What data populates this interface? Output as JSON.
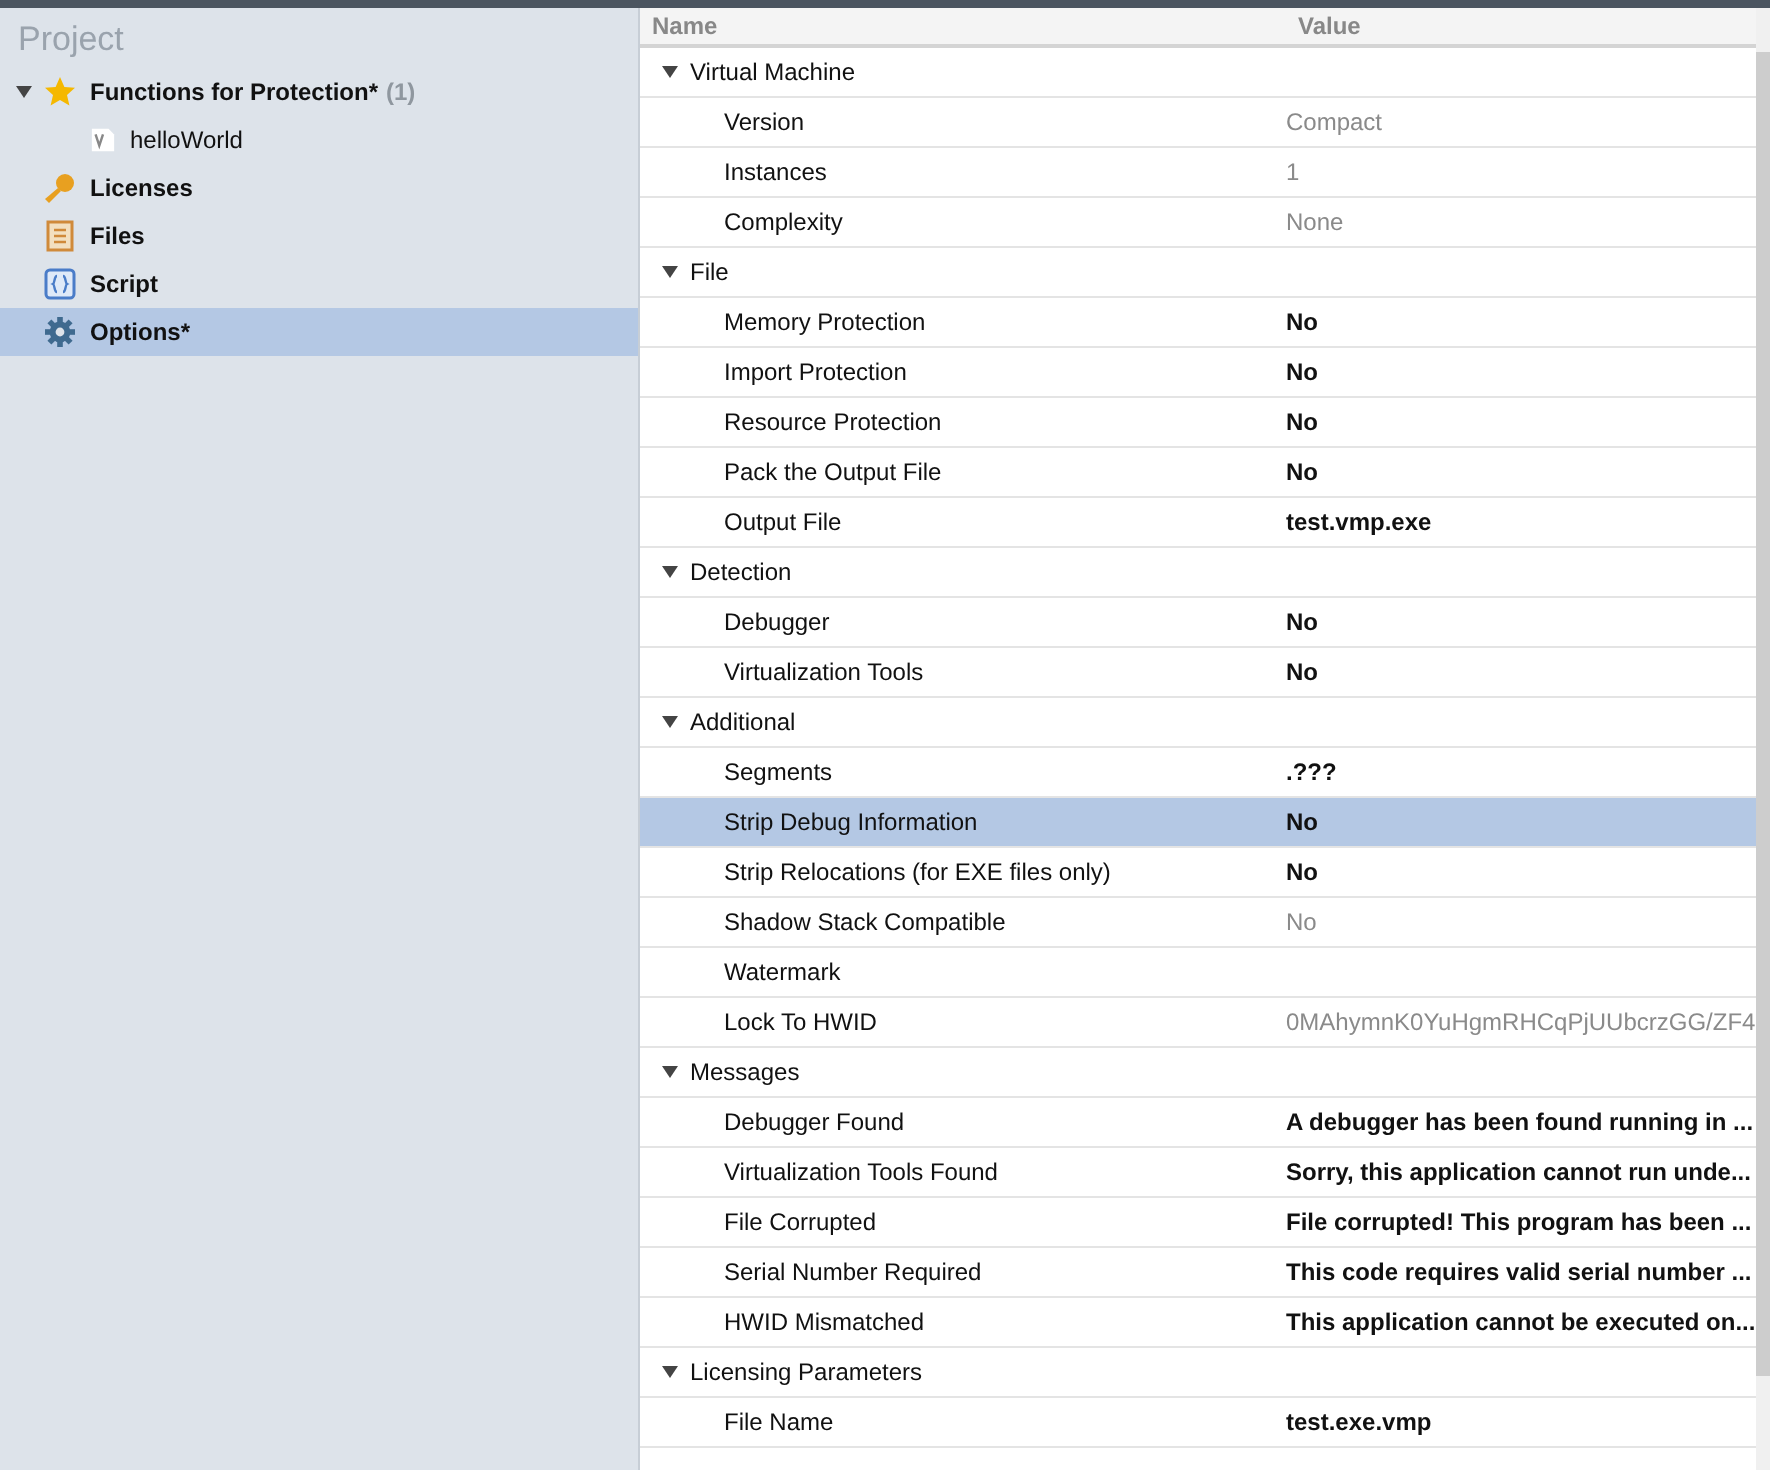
{
  "sidebar": {
    "title": "Project",
    "items": [
      {
        "label": "Functions for Protection*",
        "count": "(1)",
        "kind": "star",
        "selected": false,
        "expanded": true,
        "children": [
          {
            "label": "helloWorld",
            "kind": "vfile",
            "selected": false
          }
        ]
      },
      {
        "label": "Licenses",
        "kind": "key",
        "selected": false
      },
      {
        "label": "Files",
        "kind": "list",
        "selected": false
      },
      {
        "label": "Script",
        "kind": "braces",
        "selected": false
      },
      {
        "label": "Options*",
        "kind": "gear",
        "selected": true
      }
    ]
  },
  "table": {
    "columns": [
      "Name",
      "Value"
    ],
    "sections": [
      {
        "name": "Virtual Machine",
        "expanded": true,
        "rows": [
          {
            "name": "Version",
            "value": "Compact",
            "modified": false,
            "selected": false
          },
          {
            "name": "Instances",
            "value": "1",
            "modified": false,
            "selected": false
          },
          {
            "name": "Complexity",
            "value": "None",
            "modified": false,
            "selected": false
          }
        ]
      },
      {
        "name": "File",
        "expanded": true,
        "rows": [
          {
            "name": "Memory Protection",
            "value": "No",
            "modified": true,
            "selected": false
          },
          {
            "name": "Import Protection",
            "value": "No",
            "modified": true,
            "selected": false
          },
          {
            "name": "Resource Protection",
            "value": "No",
            "modified": true,
            "selected": false
          },
          {
            "name": "Pack the Output File",
            "value": "No",
            "modified": true,
            "selected": false
          },
          {
            "name": "Output File",
            "value": "test.vmp.exe",
            "modified": true,
            "selected": false
          }
        ]
      },
      {
        "name": "Detection",
        "expanded": true,
        "rows": [
          {
            "name": "Debugger",
            "value": "No",
            "modified": true,
            "selected": false
          },
          {
            "name": "Virtualization Tools",
            "value": "No",
            "modified": true,
            "selected": false
          }
        ]
      },
      {
        "name": "Additional",
        "expanded": true,
        "rows": [
          {
            "name": "Segments",
            "value": ".???",
            "modified": true,
            "selected": false
          },
          {
            "name": "Strip Debug Information",
            "value": "No",
            "modified": true,
            "selected": true
          },
          {
            "name": "Strip Relocations (for EXE files only)",
            "value": "No",
            "modified": true,
            "selected": false
          },
          {
            "name": "Shadow Stack Compatible",
            "value": "No",
            "modified": false,
            "selected": false
          },
          {
            "name": "Watermark",
            "selected": false
          },
          {
            "name": "Lock To HWID",
            "value": "0MAhymnK0YuHgmRHCqPjUUbcrzGG/ZF4",
            "modified": false,
            "selected": false
          }
        ]
      },
      {
        "name": "Messages",
        "expanded": true,
        "rows": [
          {
            "name": "Debugger Found",
            "value": "A debugger has been found running in ...",
            "modified": true,
            "selected": false
          },
          {
            "name": "Virtualization Tools Found",
            "value": "Sorry, this application cannot run unde...",
            "modified": true,
            "selected": false
          },
          {
            "name": "File Corrupted",
            "value": "File corrupted! This program has been ...",
            "modified": true,
            "selected": false
          },
          {
            "name": "Serial Number Required",
            "value": "This code requires valid serial number ...",
            "modified": true,
            "selected": false
          },
          {
            "name": "HWID Mismatched",
            "value": "This application cannot be executed on...",
            "modified": true,
            "selected": false
          }
        ]
      },
      {
        "name": "Licensing Parameters",
        "expanded": true,
        "rows": [
          {
            "name": "File Name",
            "value": "test.exe.vmp",
            "modified": true,
            "selected": false
          }
        ]
      }
    ]
  }
}
